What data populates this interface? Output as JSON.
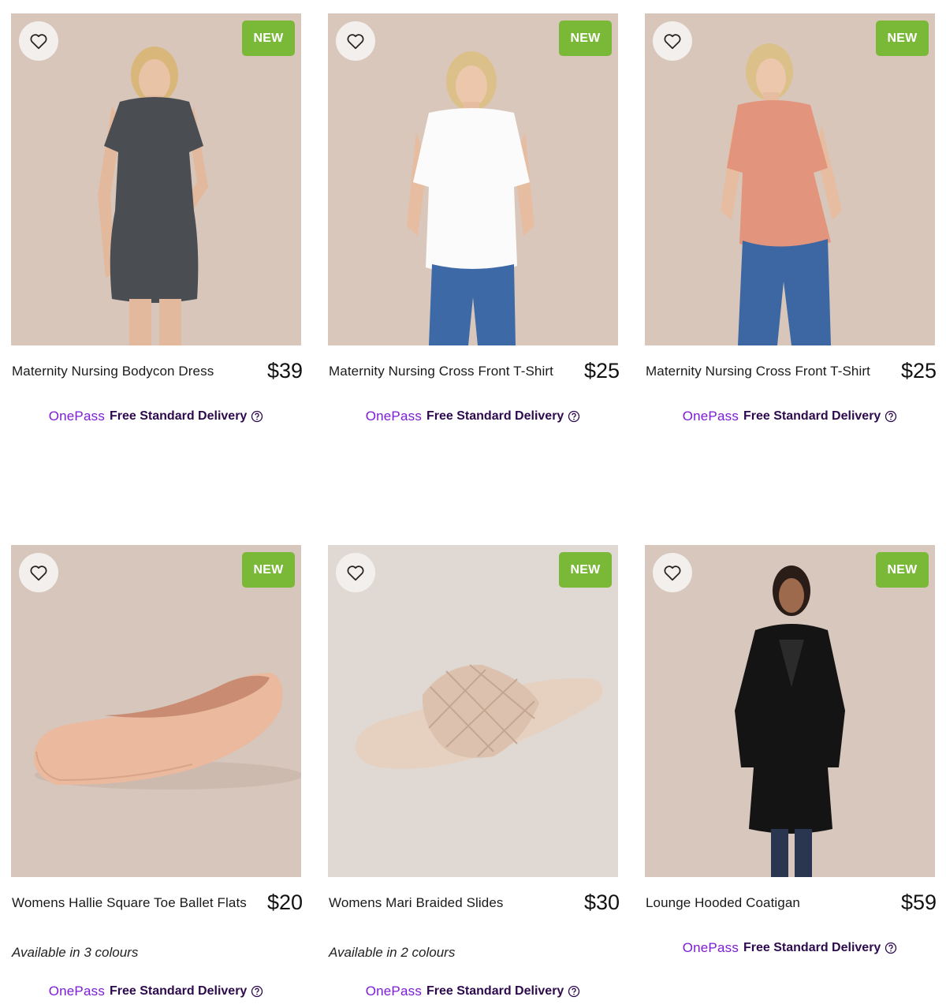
{
  "theme": {
    "badge_color": "#7ab838",
    "onepass_color": "#7d1bd6",
    "delivery_text_color": "#2d0a4d"
  },
  "products": [
    {
      "title": "Maternity Nursing Bodycon Dress",
      "price": "$39",
      "badge": "NEW",
      "colours_note": "",
      "onepass": "OnePass",
      "delivery": "Free Standard Delivery",
      "image": "model-grey-dress"
    },
    {
      "title": "Maternity Nursing Cross Front T-Shirt",
      "price": "$25",
      "badge": "NEW",
      "colours_note": "",
      "onepass": "OnePass",
      "delivery": "Free Standard Delivery",
      "image": "model-white-tshirt"
    },
    {
      "title": "Maternity Nursing Cross Front T-Shirt",
      "price": "$25",
      "badge": "NEW",
      "colours_note": "",
      "onepass": "OnePass",
      "delivery": "Free Standard Delivery",
      "image": "model-peach-tshirt"
    },
    {
      "title": "Womens Hallie Square Toe Ballet Flats",
      "price": "$20",
      "badge": "NEW",
      "colours_note": "Available in 3 colours",
      "onepass": "OnePass",
      "delivery": "Free Standard Delivery",
      "image": "ballet-flat-shoe"
    },
    {
      "title": "Womens Mari Braided Slides",
      "price": "$30",
      "badge": "NEW",
      "colours_note": "Available in 2 colours",
      "onepass": "OnePass",
      "delivery": "Free Standard Delivery",
      "image": "braided-slide"
    },
    {
      "title": "Lounge Hooded Coatigan",
      "price": "$59",
      "badge": "NEW",
      "colours_note": "",
      "onepass": "OnePass",
      "delivery": "Free Standard Delivery",
      "image": "model-black-coatigan"
    }
  ]
}
